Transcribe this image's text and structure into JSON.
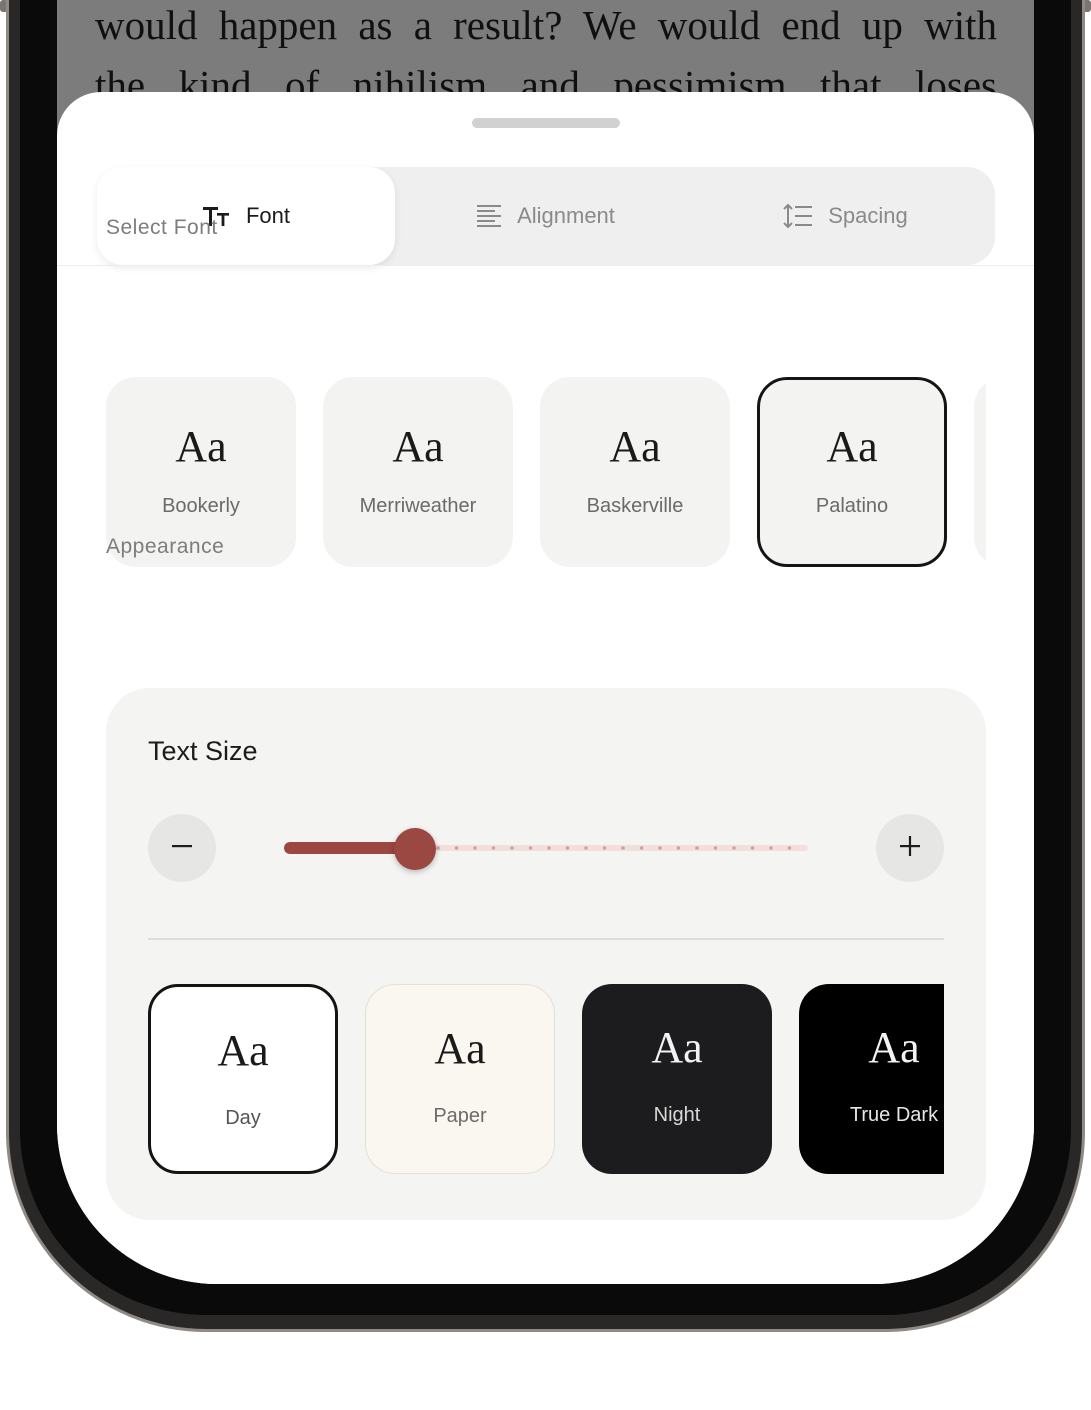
{
  "reader": {
    "line1": "would happen as a result? We would end up with",
    "line2": "the kind of nihilism and pessimism that loses"
  },
  "tabs": [
    {
      "label": "Font",
      "icon": "text-size-icon",
      "active": true
    },
    {
      "label": "Alignment",
      "icon": "align-left-icon",
      "active": false
    },
    {
      "label": "Spacing",
      "icon": "line-spacing-icon",
      "active": false
    }
  ],
  "select_font": {
    "label": "Select Font",
    "options": [
      {
        "sample": "Aa",
        "name": "Bookerly",
        "selected": false
      },
      {
        "sample": "Aa",
        "name": "Merriweather",
        "selected": false
      },
      {
        "sample": "Aa",
        "name": "Baskerville",
        "selected": false
      },
      {
        "sample": "Aa",
        "name": "Palatino",
        "selected": true
      }
    ]
  },
  "appearance": {
    "label": "Appearance",
    "text_size": {
      "title": "Text Size",
      "decrease_symbol": "−",
      "increase_symbol": "+",
      "level_fraction": 0.25
    },
    "themes": [
      {
        "sample": "Aa",
        "name": "Day",
        "selected": true,
        "bg": "#ffffff",
        "fg": "#1a1a1a",
        "label_color": "#555555"
      },
      {
        "sample": "Aa",
        "name": "Paper",
        "selected": false,
        "bg": "#faf7f0",
        "fg": "#1a1a1a",
        "label_color": "#6a6a6a"
      },
      {
        "sample": "Aa",
        "name": "Night",
        "selected": false,
        "bg": "#1c1c1e",
        "fg": "#f2f2f2",
        "label_color": "#d8d8d8"
      },
      {
        "sample": "Aa",
        "name": "True Dark",
        "selected": false,
        "bg": "#000000",
        "fg": "#f2f2f2",
        "label_color": "#e6e6e6"
      }
    ]
  },
  "colors": {
    "accent": "#9b4742",
    "accent_track": "#f3dede"
  }
}
